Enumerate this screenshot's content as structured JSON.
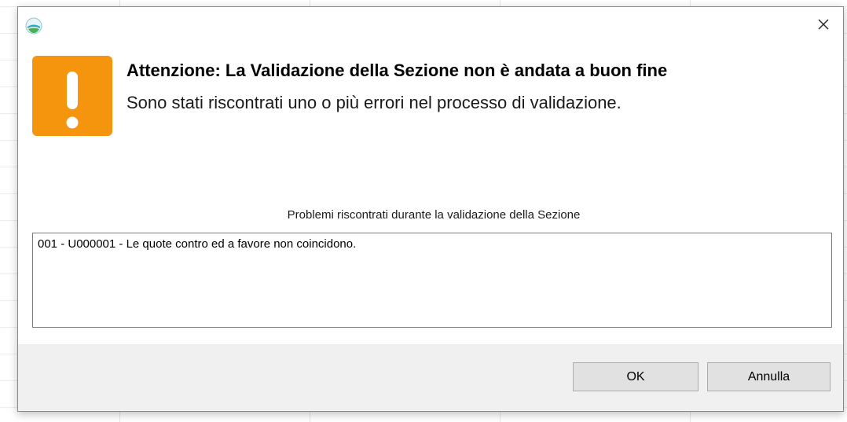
{
  "dialog": {
    "title": "Attenzione: La Validazione della Sezione non è andata a buon fine",
    "subtitle": "Sono stati riscontrati uno o più errori nel processo di validazione.",
    "icon": "warning-exclamation-icon",
    "app_icon": "app-logo-icon",
    "close_icon": "close-icon",
    "accent_color": "#f5950d"
  },
  "problems": {
    "label": "Problemi riscontrati durante la validazione della Sezione",
    "items": [
      "001 - U000001 - Le quote contro ed a favore non coincidono."
    ]
  },
  "buttons": {
    "ok_label": "OK",
    "cancel_label": "Annulla"
  }
}
